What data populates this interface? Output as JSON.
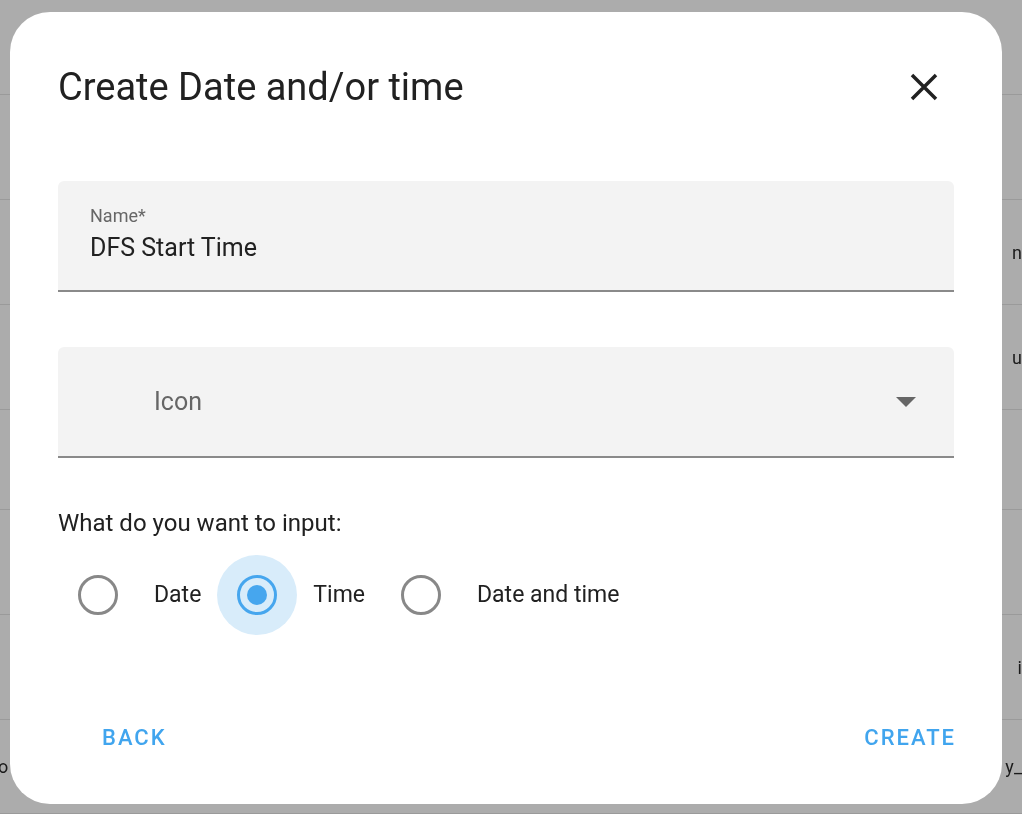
{
  "background_rows": [
    {},
    {},
    {
      "right": "n"
    },
    {
      "right": "u"
    },
    {},
    {},
    {
      "right": "i"
    },
    {
      "left": "o",
      "right": "y_"
    }
  ],
  "dialog": {
    "title": "Create Date and/or time",
    "name_field": {
      "label": "Name*",
      "value": "DFS Start Time"
    },
    "icon_field": {
      "placeholder": "Icon"
    },
    "question": "What do you want to input:",
    "options": [
      {
        "label": "Date",
        "selected": false
      },
      {
        "label": "Time",
        "selected": true
      },
      {
        "label": "Date and time",
        "selected": false
      }
    ],
    "buttons": [
      {
        "label": "BACK",
        "kind": "secondary"
      },
      {
        "label": "CREATE",
        "kind": "primary"
      }
    ]
  }
}
